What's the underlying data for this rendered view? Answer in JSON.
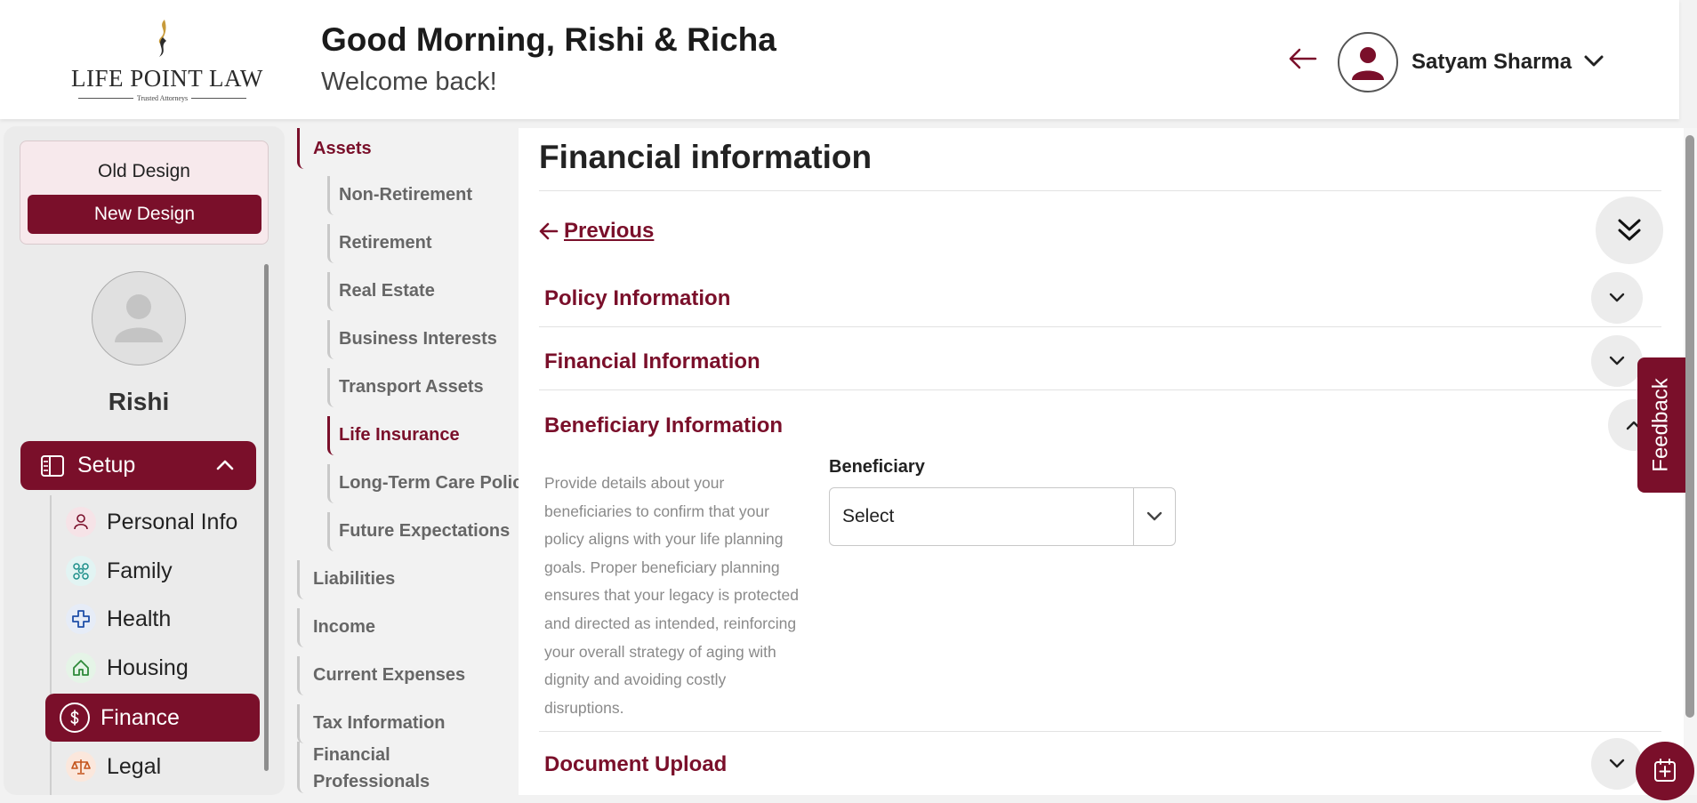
{
  "header": {
    "logo_text": "LIFE POINT LAW",
    "logo_tagline": "Trusted Attorneys",
    "greeting": "Good Morning, Rishi & Richa",
    "welcome": "Welcome back!",
    "user_name": "Satyam Sharma"
  },
  "sidebar": {
    "old_design_label": "Old Design",
    "new_design_label": "New Design",
    "profile_name": "Rishi",
    "setup_label": "Setup",
    "items": [
      {
        "label": "Personal Info",
        "icon": "person-icon"
      },
      {
        "label": "Family",
        "icon": "family-icon"
      },
      {
        "label": "Health",
        "icon": "health-cross-icon"
      },
      {
        "label": "Housing",
        "icon": "house-icon"
      },
      {
        "label": "Finance",
        "icon": "dollar-icon",
        "active": true
      },
      {
        "label": "Legal",
        "icon": "legal-scale-icon"
      }
    ]
  },
  "subnav": {
    "assets_label": "Assets",
    "asset_items": [
      "Non-Retirement",
      "Retirement",
      "Real Estate",
      "Business Interests",
      "Transport Assets",
      "Life Insurance",
      "Long-Term Care Policy",
      "Future Expectations"
    ],
    "active_asset": "Life Insurance",
    "top_items": [
      "Liabilities",
      "Income",
      "Current Expenses",
      "Tax Information",
      "Financial Professionals"
    ]
  },
  "main": {
    "title": "Financial information",
    "previous_label": "Previous",
    "sections": {
      "policy": "Policy Information",
      "financial": "Financial Information",
      "beneficiary": "Beneficiary Information",
      "document": "Document Upload"
    },
    "beneficiary_description": "Provide details about your beneficiaries to confirm that your policy aligns with your life planning goals. Proper beneficiary planning ensures that your legacy is protected and directed as intended, reinforcing your overall strategy of aging with dignity and avoiding costly disruptions.",
    "beneficiary_label": "Beneficiary",
    "beneficiary_select_value": "Select"
  },
  "feedback_label": "Feedback",
  "colors": {
    "brand": "#7a0f2a",
    "muted_text": "#8a8a8a"
  }
}
